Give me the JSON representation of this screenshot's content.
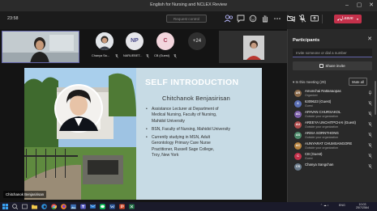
{
  "window": {
    "title": "English for Nursing and NCLEX Review"
  },
  "toolbar": {
    "timer": "23:58",
    "request_control": "Request control",
    "leave": "Leave"
  },
  "roster": [
    {
      "initials": "",
      "label": "Chanya Sa..."
    },
    {
      "initials": "NP",
      "label": "NARUEBET..."
    },
    {
      "initials": "C",
      "label": "CB (Guest)"
    }
  ],
  "more_count": "+24",
  "slide": {
    "title": "SELF INTRODUCTION",
    "name": "Chitchanok Benjasirisan",
    "bullets": [
      [
        "Assistance Lecturer at  Department of",
        "Medical Nursing, Faculty of Nursing,",
        "Mahidol University"
      ],
      [
        "BSN, Faculty of Nursing, Mahidol University"
      ],
      [
        "Currently studying in MSN, Adult",
        "Gerontology Primary Care Nurse",
        "Practitioner, Russell Sage College,",
        "Troy, New York"
      ]
    ]
  },
  "presenter_badge": "Chitchanok Benjasirisan",
  "participants": {
    "title": "Participants",
    "invite_placeholder": "Invite someone or dial a number",
    "share_invite": "Share invite",
    "section_label": "In this meeting (29)",
    "mute_all": "Mute all",
    "items": [
      {
        "initials": "AR",
        "name": "Amonchai Rattanaopas",
        "role": "Organizer",
        "color": "#8a6a4a"
      },
      {
        "initials": "6",
        "name": "6309623 (Guest)",
        "role": "Guest",
        "color": "#5b6fb5"
      },
      {
        "initials": "AC",
        "name": "APAVAN CHURSAKOL",
        "role": "Outside your organization",
        "color": "#7b5ea7"
      },
      {
        "initials": "AU",
        "name": "AREEYA UNCHITPCHAI (Guest)",
        "role": "Outside your organization",
        "color": "#b14d4d"
      },
      {
        "initials": "AS",
        "name": "ARISA SORNTHONG",
        "role": "Outside your organization",
        "color": "#4d8a6a"
      },
      {
        "initials": "AC",
        "name": "AUNYARAT CHUMSANGORE",
        "role": "Outside your organization",
        "color": "#b7833e"
      },
      {
        "initials": "C",
        "name": "CB (Guest)",
        "role": "Guest",
        "color": "#c4314b"
      },
      {
        "initials": "CS",
        "name": "Chanya Sangchan",
        "role": "",
        "color": "#6a7a8a"
      }
    ]
  },
  "tray": {
    "lang": "ENG",
    "time": "10:03",
    "date": "25/7/2564"
  },
  "colors": {
    "accent": "#6264a7",
    "leave": "#c4314b",
    "slide_bg": "#c7dbe5"
  }
}
